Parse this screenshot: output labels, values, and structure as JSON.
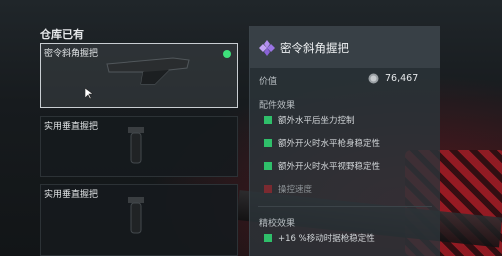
{
  "inventory": {
    "title": "仓库已有",
    "items": [
      {
        "name": "密令斜角握把",
        "selected": true,
        "equipped_indicator_color": "#3ee07a"
      },
      {
        "name": "实用垂直握把",
        "selected": false
      },
      {
        "name": "实用垂直握把",
        "selected": false
      }
    ]
  },
  "detail": {
    "title": "密令斜角握把",
    "rarity_color": "#b28ef0",
    "price_label": "价值",
    "price_value": "76,467",
    "effects_heading": "配件效果",
    "effects": [
      "额外水平后坐力控制",
      "额外开火时水平枪身稳定性",
      "额外开火时水平视野稳定性",
      "操控速度"
    ],
    "tuning_heading": "精校效果",
    "tuning_effect": "+16 %移动时据枪稳定性"
  },
  "colors": {
    "positive": "#2fbf6a",
    "negative": "#7a2a30"
  }
}
